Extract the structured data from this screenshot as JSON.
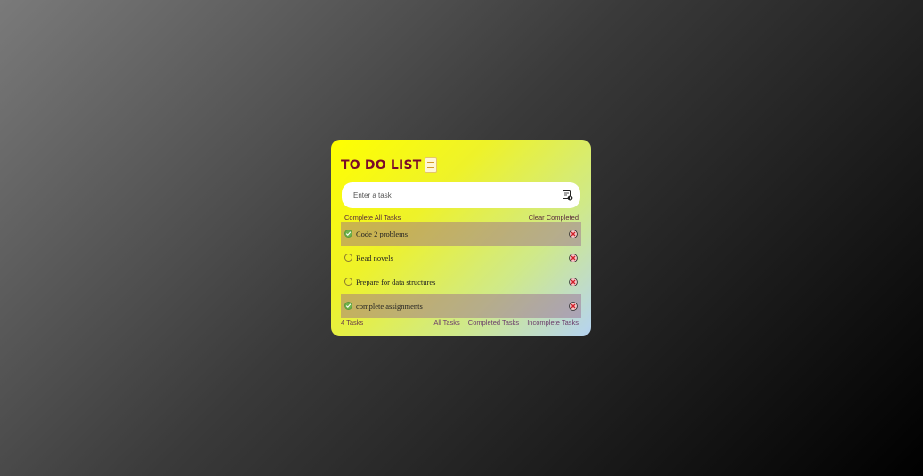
{
  "app": {
    "title": "TO DO LIST",
    "title_icon": "notepad-icon"
  },
  "input": {
    "placeholder": "Enter a task",
    "value": "",
    "add_icon": "add-task-icon"
  },
  "controls": {
    "complete_all": "Complete All Tasks",
    "clear_completed": "Clear Completed"
  },
  "tasks": [
    {
      "text": "Code 2 problems",
      "completed": true
    },
    {
      "text": "Read novels",
      "completed": false
    },
    {
      "text": "Prepare for data structures",
      "completed": false
    },
    {
      "text": "complete assignments",
      "completed": true
    }
  ],
  "footer": {
    "count": "4 Tasks",
    "filter_all": "All Tasks",
    "filter_completed": "Completed Tasks",
    "filter_incomplete": "Incomplete Tasks"
  },
  "colors": {
    "title": "#7a0a2a",
    "completed_row": "#b08a8a",
    "check_done": "#6fb24a",
    "delete": "#d0202a"
  }
}
